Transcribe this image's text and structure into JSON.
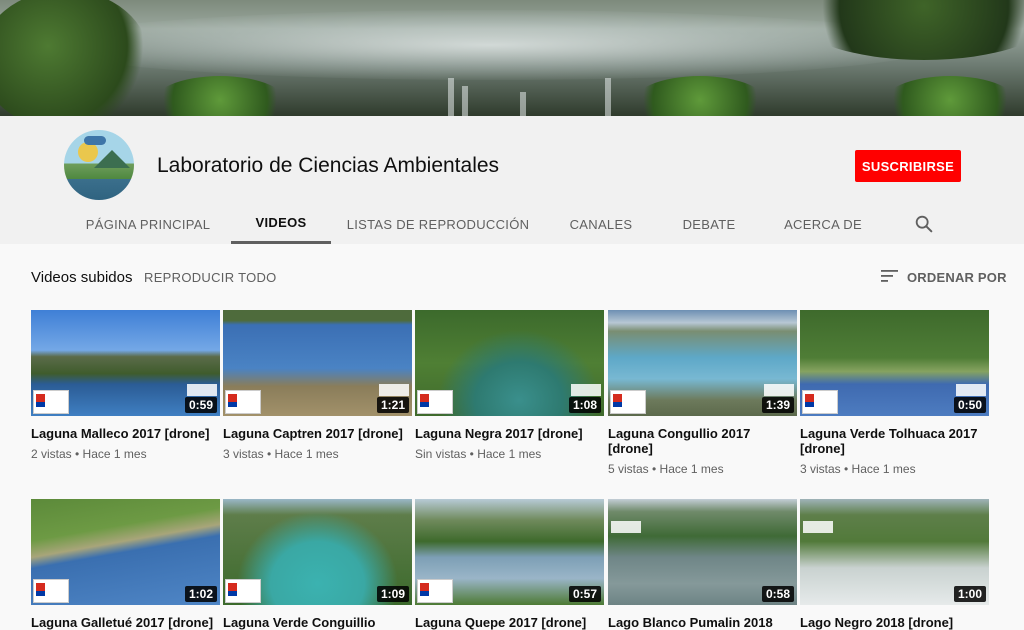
{
  "channel": {
    "name": "Laboratorio de Ciencias Ambientales",
    "subscribe_label": "SUSCRIBIRSE"
  },
  "tabs": [
    {
      "label": "PÁGINA PRINCIPAL"
    },
    {
      "label": "VIDEOS"
    },
    {
      "label": "LISTAS DE REPRODUCCIÓN"
    },
    {
      "label": "CANALES"
    },
    {
      "label": "DEBATE"
    },
    {
      "label": "ACERCA DE"
    }
  ],
  "active_tab": "VIDEOS",
  "section": {
    "title": "Videos subidos",
    "play_all": "REPRODUCIR TODO",
    "sort_label": "ORDENAR POR"
  },
  "videos": [
    {
      "title": "Laguna Malleco 2017 [drone]",
      "meta": "2 vistas • Hace 1 mes",
      "duration": "0:59"
    },
    {
      "title": "Laguna Captren 2017 [drone]",
      "meta": "3 vistas • Hace 1 mes",
      "duration": "1:21"
    },
    {
      "title": "Laguna Negra 2017 [drone]",
      "meta": "Sin vistas • Hace 1 mes",
      "duration": "1:08"
    },
    {
      "title": "Laguna Congullio 2017 [drone]",
      "meta": "5 vistas • Hace 1 mes",
      "duration": "1:39"
    },
    {
      "title": "Laguna Verde Tolhuaca 2017 [drone]",
      "meta": "3 vistas • Hace 1 mes",
      "duration": "0:50"
    },
    {
      "title": "Laguna Galletué 2017 [drone]",
      "meta": "",
      "duration": "1:02"
    },
    {
      "title": "Laguna Verde Conguillio",
      "meta": "",
      "duration": "1:09"
    },
    {
      "title": "Laguna Quepe 2017 [drone]",
      "meta": "",
      "duration": "0:57"
    },
    {
      "title": "Lago Blanco Pumalin 2018",
      "meta": "",
      "duration": "0:58"
    },
    {
      "title": "Lago Negro 2018 [drone]",
      "meta": "",
      "duration": "1:00"
    }
  ],
  "colors": {
    "subscribe": "#ff0000",
    "header_bg": "#f1f1f1",
    "page_bg": "#f9f9f9"
  }
}
